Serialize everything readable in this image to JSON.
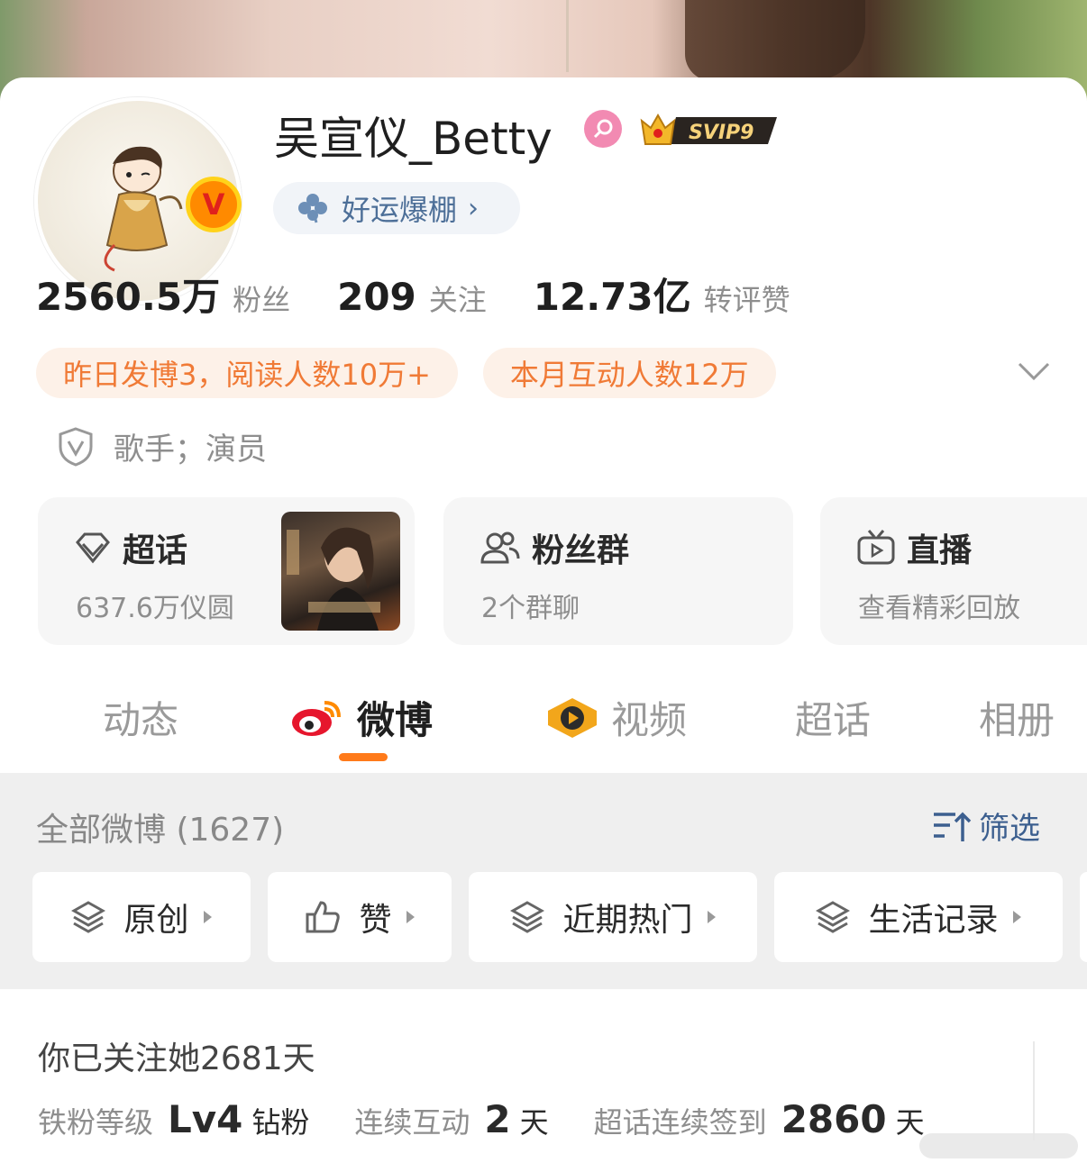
{
  "profile": {
    "name": "吴宣仪_Betty",
    "vip_label": "SVIP9",
    "luck_label": "好运爆棚",
    "verified_badge": "V"
  },
  "stats": [
    {
      "num": "2560.5万",
      "label": "粉丝"
    },
    {
      "num": "209",
      "label": "关注"
    },
    {
      "num": "12.73亿",
      "label": "转评赞"
    }
  ],
  "pills": [
    "昨日发博3，阅读人数10万+",
    "本月互动人数12万"
  ],
  "verify_text": "歌手；演员",
  "tiles": {
    "chaohua": {
      "title": "超话",
      "sub": "637.6万仪圆"
    },
    "fans_group": {
      "title": "粉丝群",
      "sub": "2个群聊"
    },
    "live": {
      "title": "直播",
      "sub": "查看精彩回放"
    }
  },
  "tabs": [
    "动态",
    "微博",
    "视频",
    "超话",
    "相册"
  ],
  "active_tab": "微博",
  "feed": {
    "all_label": "全部微博 (1627)",
    "filter_label": "筛选",
    "chips": [
      "原创",
      "赞",
      "近期热门",
      "生活记录"
    ]
  },
  "fan_info": {
    "follow_days": "你已关注她2681天",
    "level_label": "铁粉等级",
    "level_value": "Lv4",
    "level_unit": "钻粉",
    "interact_label": "连续互动",
    "interact_value": "2",
    "interact_unit": "天",
    "signin_label": "超话连续签到",
    "signin_value": "2860",
    "signin_unit": "天"
  },
  "colors": {
    "accent_orange": "#ff7a1a",
    "pill_text": "#f07a36",
    "link_blue": "#3c5f8f"
  }
}
